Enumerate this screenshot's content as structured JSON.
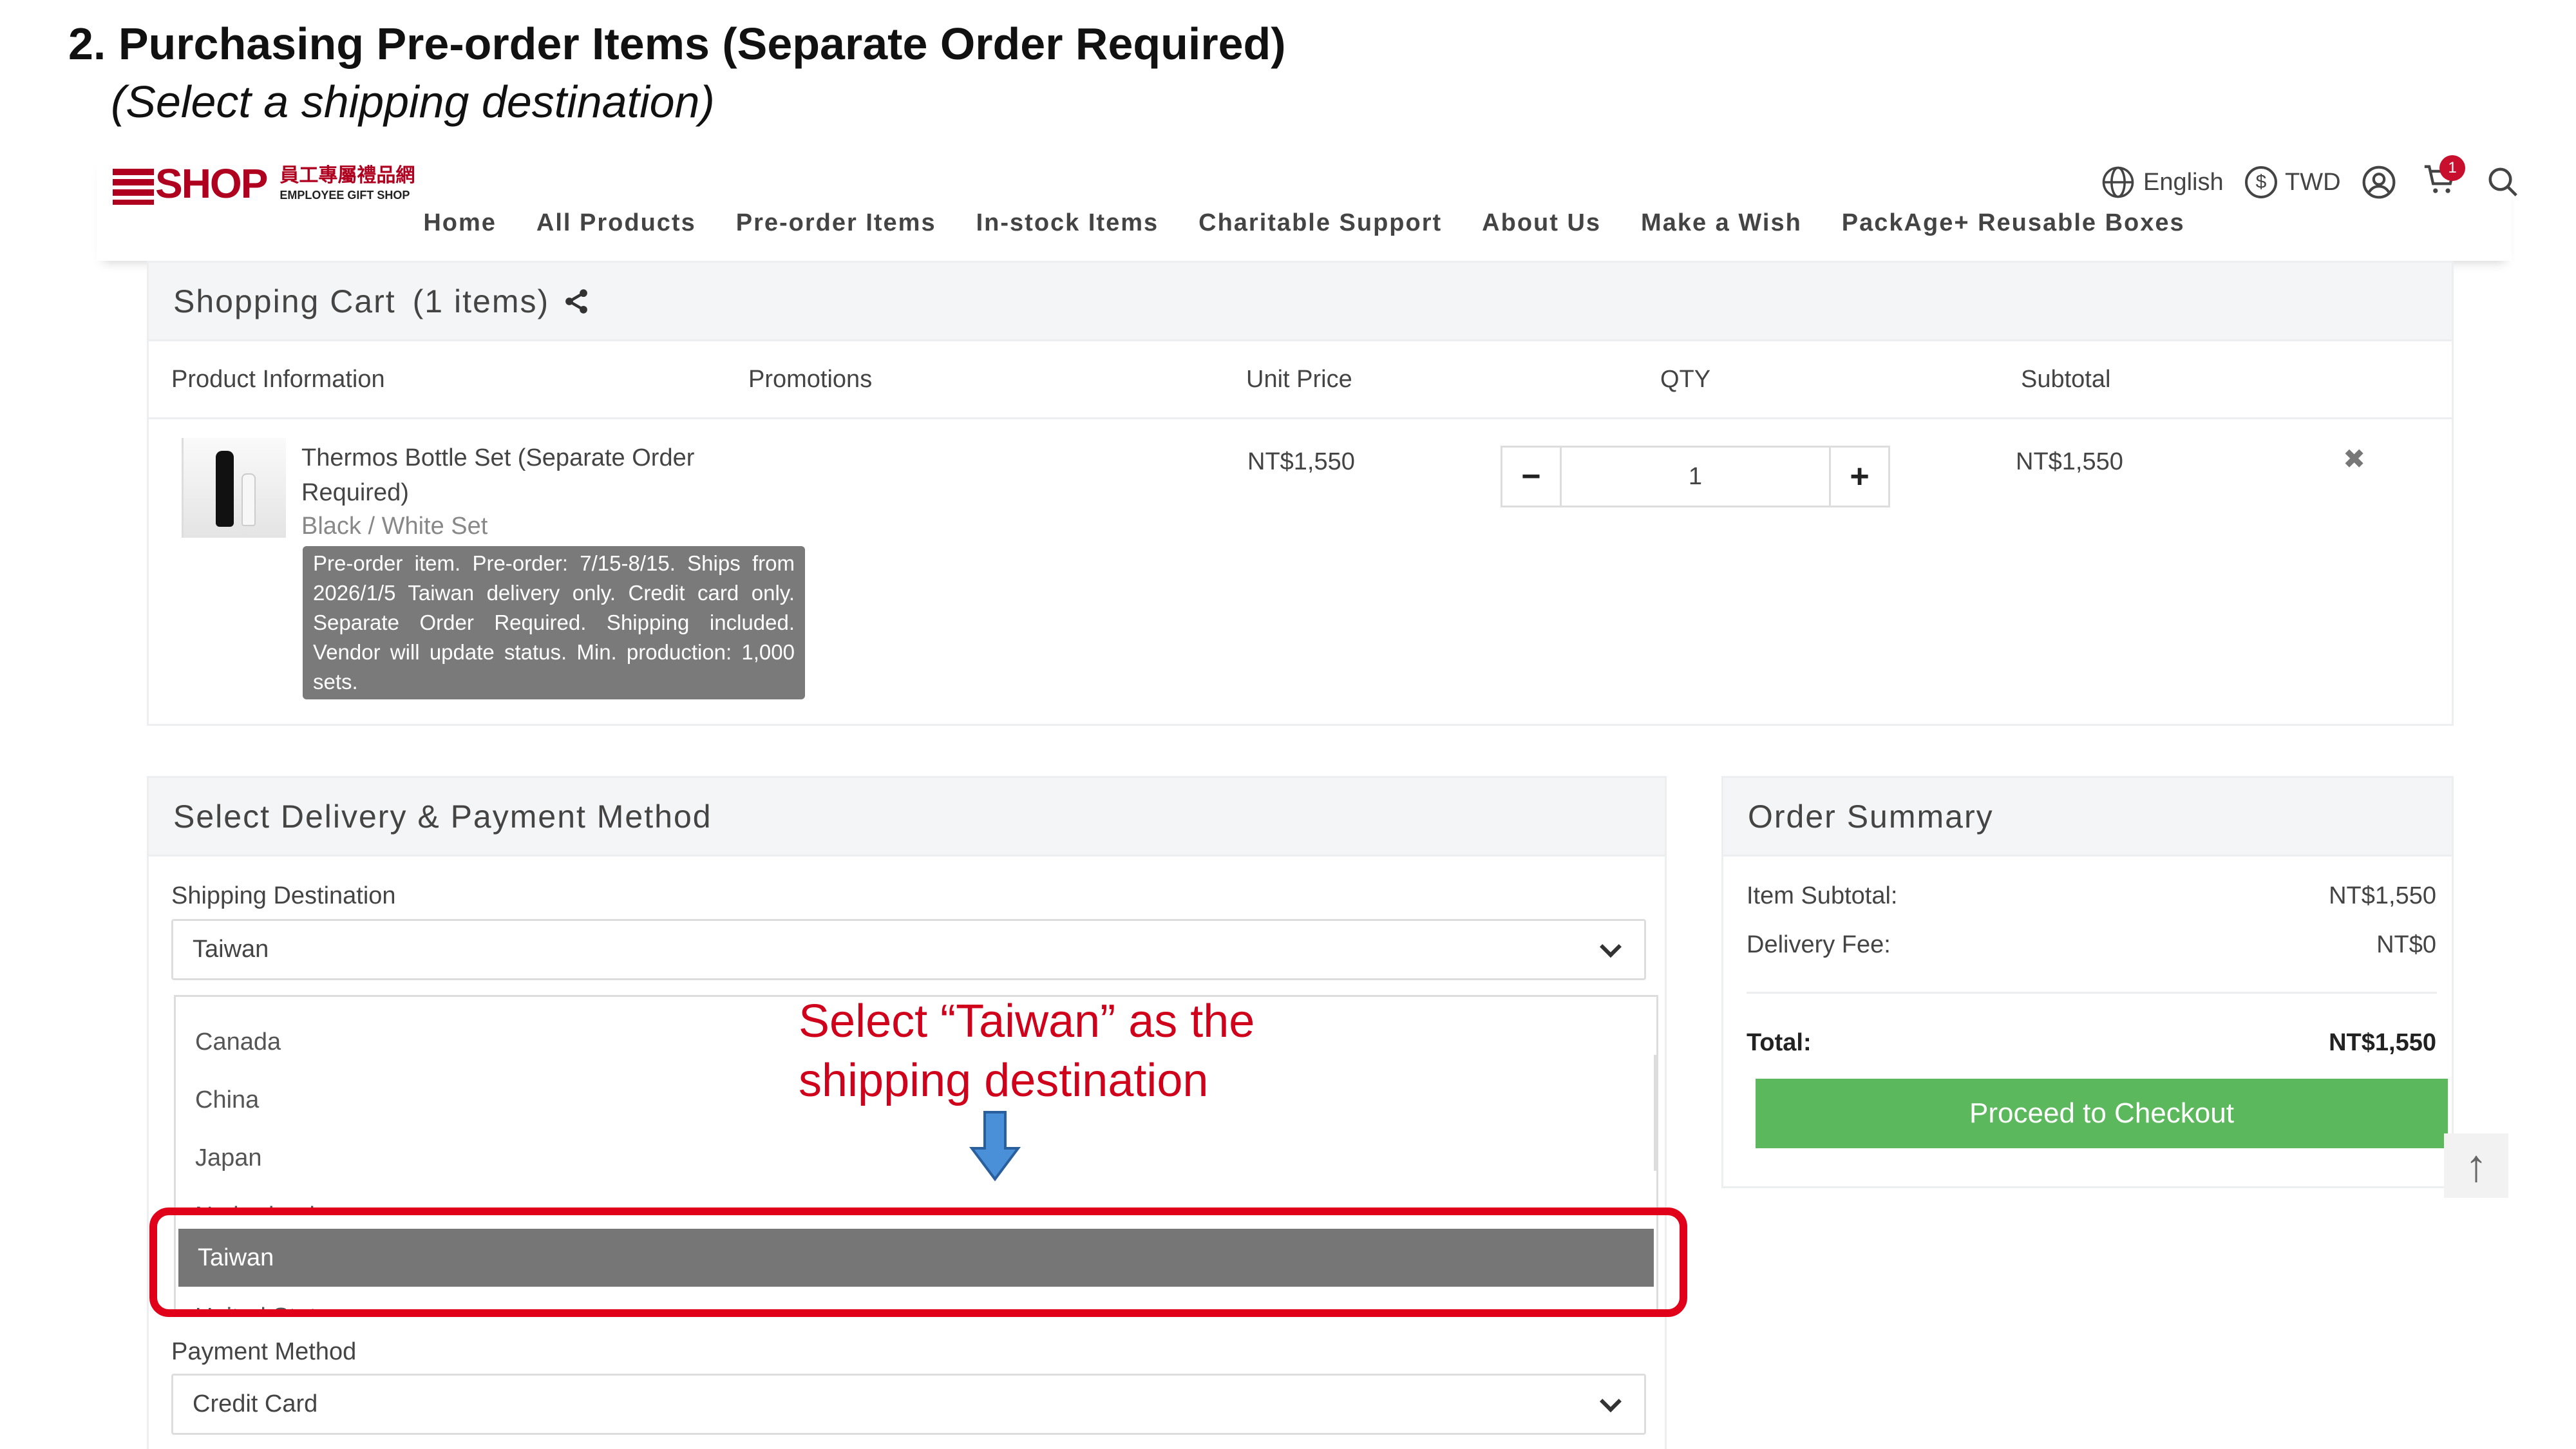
{
  "slide": {
    "title": "2. Purchasing Pre-order Items (Separate Order Required)",
    "subtitle": "(Select a shipping destination)"
  },
  "site": {
    "logo_mark": "SHOP",
    "logo_zh": "員工專屬禮品網",
    "logo_en": "EMPLOYEE GIFT SHOP",
    "language": "English",
    "currency": "TWD",
    "currency_icon": "$",
    "cart_count": "1",
    "nav": [
      "Home",
      "All Products",
      "Pre-order Items",
      "In-stock Items",
      "Charitable Support",
      "About Us",
      "Make a Wish",
      "PackAge+ Reusable Boxes"
    ]
  },
  "cart": {
    "title": "Shopping Cart",
    "count_text": "(1 items)",
    "columns": {
      "product": "Product Information",
      "promotions": "Promotions",
      "unit_price": "Unit Price",
      "qty": "QTY",
      "subtotal": "Subtotal"
    },
    "item": {
      "name_line1": "Thermos Bottle Set (Separate Order",
      "name_line2": "Required)",
      "variant": "Black / White Set",
      "note": "Pre-order item. Pre-order: 7/15-8/15. Ships from 2026/1/5 Taiwan delivery only. Credit card only. Separate Order Required. Shipping included. Vendor will update status. Min. production: 1,000 sets.",
      "unit_price": "NT$1,550",
      "qty": "1",
      "qty_minus": "−",
      "qty_plus": "+",
      "subtotal": "NT$1,550",
      "remove": "✖"
    }
  },
  "delivery": {
    "title": "Select Delivery & Payment Method",
    "shipping_label": "Shipping Destination",
    "shipping_value": "Taiwan",
    "options": [
      "Canada",
      "China",
      "Japan",
      "Netherlands",
      "Taiwan",
      "United States"
    ],
    "selected_option": "Taiwan",
    "payment_label": "Payment Method",
    "payment_value": "Credit Card"
  },
  "annotation": {
    "line1": "Select “Taiwan” as the",
    "line2": "shipping destination",
    "color": "#d0021b",
    "arrow_color": "#4a90d9"
  },
  "summary": {
    "title": "Order Summary",
    "item_subtotal_label": "Item Subtotal:",
    "item_subtotal_value": "NT$1,550",
    "delivery_fee_label": "Delivery Fee:",
    "delivery_fee_value": "NT$0",
    "total_label": "Total:",
    "total_value": "NT$1,550",
    "checkout_label": "Proceed to Checkout",
    "checkout_color": "#5cb85c"
  },
  "back_to_top": "↑"
}
